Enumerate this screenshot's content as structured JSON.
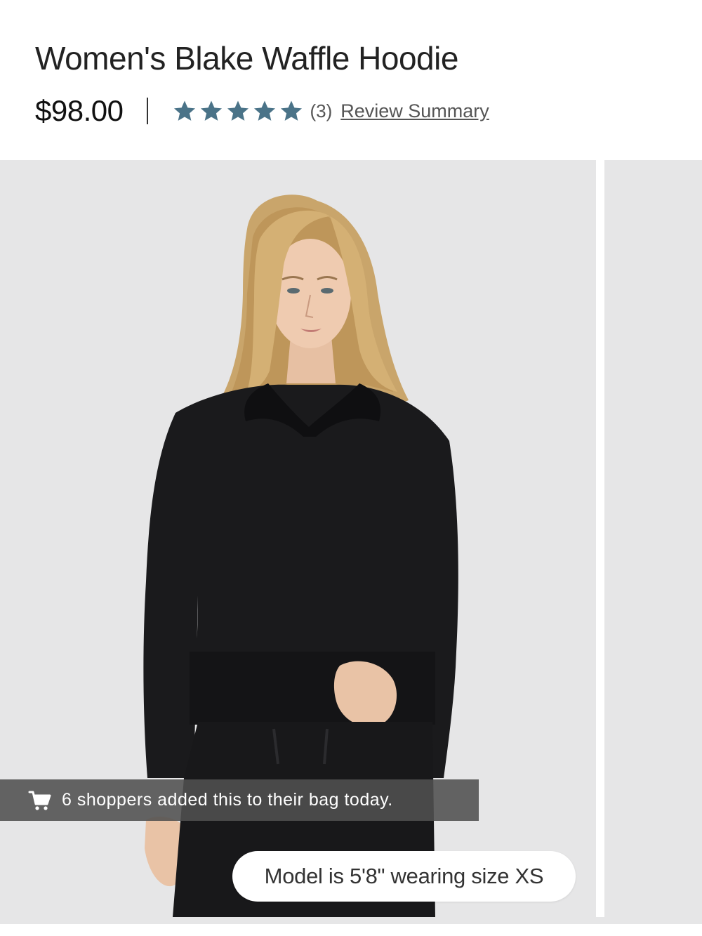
{
  "product": {
    "title": "Women's Blake Waffle Hoodie",
    "price": "$98.00",
    "divider": "|",
    "rating": {
      "stars": 5,
      "star_color": "#4a7388",
      "count_text": "(3)",
      "summary_link": "Review Summary"
    }
  },
  "gallery": {
    "background_color": "#e6e6e7",
    "bag_banner": {
      "icon": "cart-icon",
      "text": "6 shoppers added this to their bag today."
    },
    "model_info": "Model is 5'8\" wearing size XS"
  }
}
